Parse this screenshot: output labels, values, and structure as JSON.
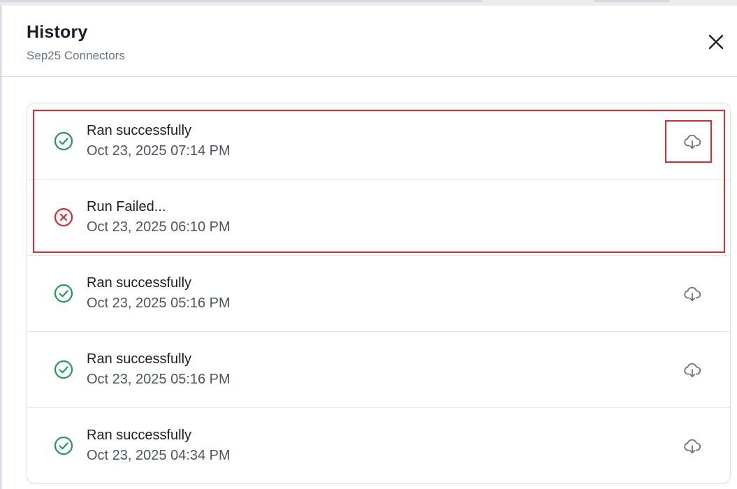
{
  "dialog": {
    "title": "History",
    "subtitle": "Sep25 Connectors",
    "close_icon": "close-icon"
  },
  "history": [
    {
      "status": "success",
      "status_icon": "check-circle-icon",
      "label": "Ran successfully",
      "timestamp": "Oct 23, 2025 07:14 PM",
      "download_icon": "cloud-download-icon",
      "downloadable": true
    },
    {
      "status": "failed",
      "status_icon": "x-circle-icon",
      "label": "Run Failed...",
      "timestamp": "Oct 23, 2025 06:10 PM",
      "downloadable": false
    },
    {
      "status": "success",
      "status_icon": "check-circle-icon",
      "label": "Ran successfully",
      "timestamp": "Oct 23, 2025 05:16 PM",
      "download_icon": "cloud-download-icon",
      "downloadable": true
    },
    {
      "status": "success",
      "status_icon": "check-circle-icon",
      "label": "Ran successfully",
      "timestamp": "Oct 23, 2025 05:16 PM",
      "download_icon": "cloud-download-icon",
      "downloadable": true
    },
    {
      "status": "success",
      "status_icon": "check-circle-icon",
      "label": "Ran successfully",
      "timestamp": "Oct 23, 2025 04:34 PM",
      "download_icon": "cloud-download-icon",
      "downloadable": true
    }
  ],
  "colors": {
    "success": "#1f9d55",
    "failed": "#e0282e",
    "highlight": "#e0282e",
    "icon_gray": "#6b7280"
  }
}
